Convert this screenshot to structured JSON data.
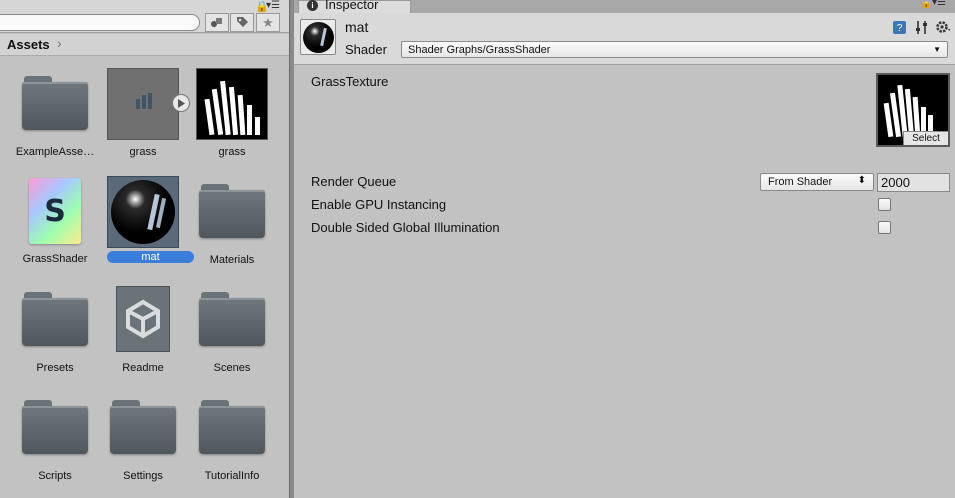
{
  "project": {
    "breadcrumb": "Assets",
    "assets": [
      {
        "label": "ExampleAsse…",
        "kind": "folder"
      },
      {
        "label": "grass",
        "kind": "texture-asset"
      },
      {
        "label": "grass",
        "kind": "texture"
      },
      {
        "label": "GrassShader",
        "kind": "shader-graph",
        "icon_letter": "S"
      },
      {
        "label": "mat",
        "kind": "material",
        "selected": true
      },
      {
        "label": "Materials",
        "kind": "folder"
      },
      {
        "label": "Presets",
        "kind": "folder"
      },
      {
        "label": "Readme",
        "kind": "unity-asset"
      },
      {
        "label": "Scenes",
        "kind": "folder"
      },
      {
        "label": "Scripts",
        "kind": "folder"
      },
      {
        "label": "Settings",
        "kind": "folder"
      },
      {
        "label": "TutorialInfo",
        "kind": "folder"
      }
    ]
  },
  "inspector": {
    "tab_title": "Inspector",
    "info_glyph": "i",
    "object_name": "mat",
    "shader_label": "Shader",
    "shader_value": "Shader Graphs/GrassShader",
    "properties": {
      "grass_texture_label": "GrassTexture",
      "texture_select": "Select",
      "render_queue_label": "Render Queue",
      "render_queue_mode": "From Shader",
      "render_queue_value": "2000",
      "gpu_instancing_label": "Enable GPU Instancing",
      "gpu_instancing_checked": false,
      "double_sided_gi_label": "Double Sided Global Illumination",
      "double_sided_gi_checked": false
    }
  },
  "colors": {
    "selection": "#3a7ddb",
    "panel_bg": "#c2c2c2",
    "header_bg": "#d9d9d9",
    "folder": "#5f686c"
  }
}
